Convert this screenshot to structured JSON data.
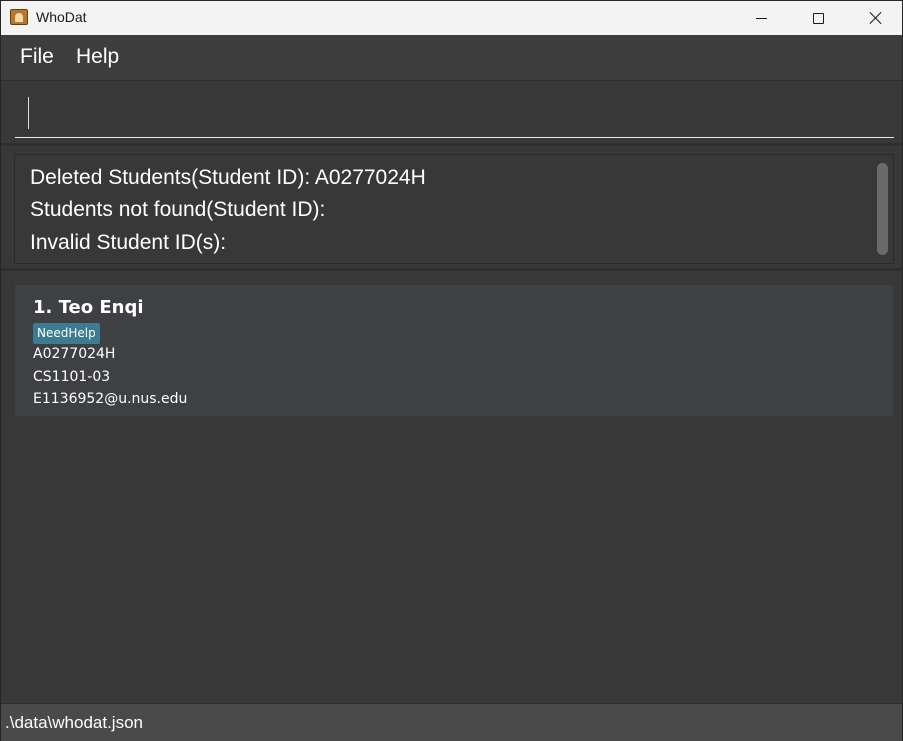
{
  "window": {
    "title": "WhoDat"
  },
  "menu": {
    "items": [
      {
        "label": "File"
      },
      {
        "label": "Help"
      }
    ]
  },
  "command": {
    "value": "",
    "placeholder": ""
  },
  "result": {
    "lines": [
      "Deleted Students(Student ID): A0277024H",
      "Students not found(Student ID):",
      "Invalid Student ID(s):"
    ]
  },
  "students": [
    {
      "index_name": "1. Teo Enqi",
      "tags": [
        "NeedHelp"
      ],
      "student_id": "A0277024H",
      "class": "CS1101-03",
      "email": "E1136952@u.nus.edu"
    }
  ],
  "status": {
    "file_path": ".\\data\\whodat.json"
  },
  "colors": {
    "tag_background": "#3e7b91",
    "card_background": "#3f4043",
    "window_background": "#383838"
  },
  "icons": [
    "app-icon",
    "minimize-icon",
    "maximize-icon",
    "close-icon"
  ]
}
